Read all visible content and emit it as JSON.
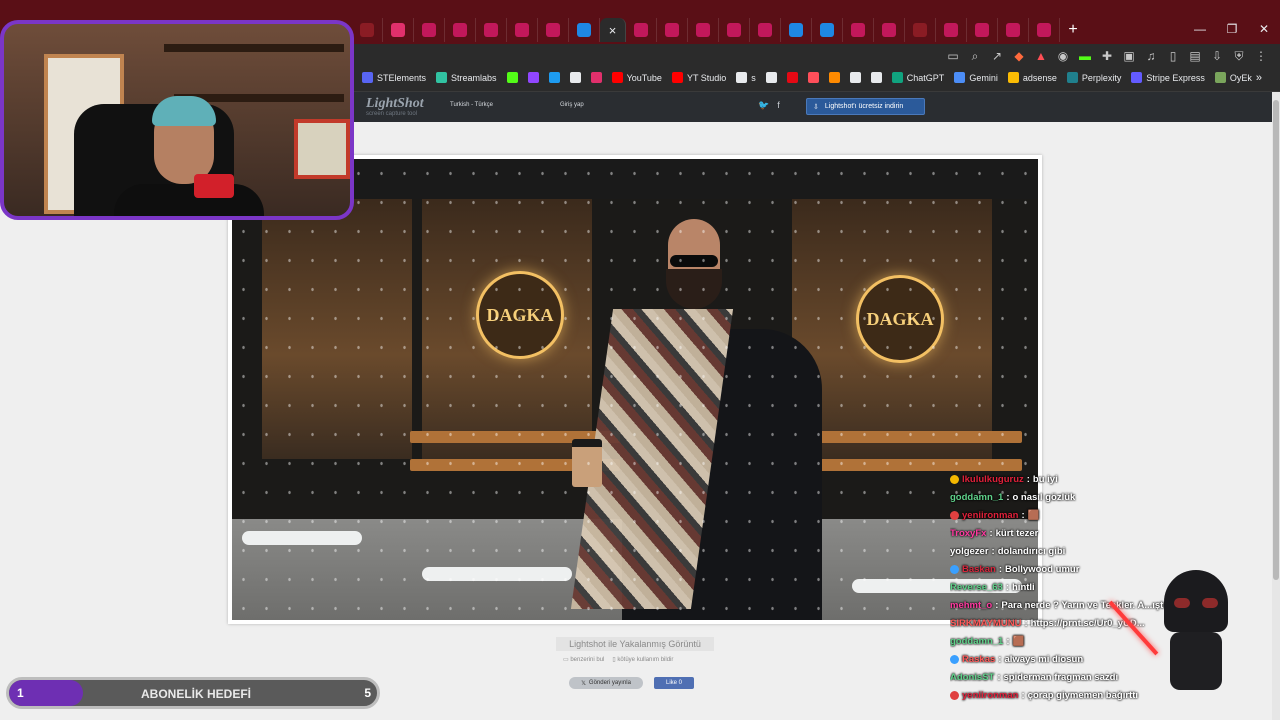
{
  "tabs": {
    "favicon_colors": [
      "#8a1c24",
      "#e1306c",
      "#c2185b",
      "#c2185b",
      "#c2185b",
      "#c2185b",
      "#c2185b",
      "#1e88e5",
      "#2b2b2b",
      "#c2185b",
      "#c2185b",
      "#c2185b",
      "#c2185b",
      "#c2185b",
      "#1e88e5",
      "#1e88e5",
      "#c2185b",
      "#c2185b",
      "#8a1c24",
      "#c2185b",
      "#c2185b",
      "#c2185b",
      "#c2185b"
    ],
    "active_index": 8,
    "close_glyph": "×",
    "new_tab_glyph": "+"
  },
  "window_controls": {
    "minimize": "—",
    "maximize": "❐",
    "close": "✕"
  },
  "bookmarks": [
    {
      "label": "STElements",
      "color": "#5865f2"
    },
    {
      "label": "Streamlabs",
      "color": "#31c3a2"
    },
    {
      "label": "",
      "color": "#53fc18"
    },
    {
      "label": "",
      "color": "#9146ff"
    },
    {
      "label": "",
      "color": "#1d9bf0"
    },
    {
      "label": "",
      "color": "#e8eaed",
      "glyph": "X"
    },
    {
      "label": "",
      "color": "#e1306c"
    },
    {
      "label": "YouTube",
      "color": "#ff0000"
    },
    {
      "label": "YT Studio",
      "color": "#ff0000"
    },
    {
      "label": "s",
      "color": "#e8eaed"
    },
    {
      "label": "",
      "color": "#e8eaed"
    },
    {
      "label": "",
      "color": "#e50914"
    },
    {
      "label": "",
      "color": "#ff4f5a"
    },
    {
      "label": "",
      "color": "#ff8a00"
    },
    {
      "label": "",
      "color": "#e8eaed"
    },
    {
      "label": "",
      "color": "#e8eaed"
    },
    {
      "label": "ChatGPT",
      "color": "#10a37f"
    },
    {
      "label": "Gemini",
      "color": "#4c8df6"
    },
    {
      "label": "adsense",
      "color": "#fbbc04"
    },
    {
      "label": "Perplexity",
      "color": "#20808d"
    },
    {
      "label": "Stripe Express",
      "color": "#635bff"
    },
    {
      "label": "OyEk",
      "color": "#7aa55c"
    }
  ],
  "bookmarks_more": "»",
  "lightshot": {
    "logo": "LightShot",
    "tagline": "screen capture tool",
    "language": "Turkish - Türkçe",
    "login": "Giriş yap",
    "social": [
      "🐦",
      "f"
    ],
    "download_label": "Lightshot'ı ücretsiz indirin",
    "caption": "Lightshot ile Yakalanmış Görüntü",
    "find_similar": "benzerini bul",
    "report_abuse": "kötüye kullanım bildir",
    "tweet_label": "Gönderi yayınla",
    "like_label": "Like 0"
  },
  "photo": {
    "sign_text": "DAGKA"
  },
  "chat": [
    {
      "user": "lkululkuguruz",
      "text": "bu iyi",
      "color": "#e0203a",
      "badge": "#f5b800"
    },
    {
      "user": "goddamn_1",
      "text": "o nasıl gözlük",
      "color": "#5fd18a",
      "badge": ""
    },
    {
      "user": "yeniironman",
      "text": "🟫",
      "color": "#e0203a",
      "badge": "#e04040"
    },
    {
      "user": "TroxyFx",
      "text": "kürt tezer",
      "color": "#ff3aa0",
      "badge": ""
    },
    {
      "user": "yolgezer",
      "text": "dolandırıcı gibi",
      "color": "#ffffff",
      "badge": ""
    },
    {
      "user": "Baskan",
      "text": "Bollywood umur",
      "color": "#d7263d",
      "badge": "#3aa0ff"
    },
    {
      "user": "Reverse_63",
      "text": "hintli",
      "color": "#5fd18a",
      "badge": ""
    },
    {
      "user": "mehmt_o",
      "text": "Para nerde ? Yarın ve Teekler. A...ıştırde.",
      "color": "#ff3aa0",
      "badge": ""
    },
    {
      "user": "SIRKMAYMUNU",
      "text": "https://prnt.sc/Ur0_yUD...",
      "color": "#ff5a5a",
      "badge": ""
    },
    {
      "user": "goddamn_1",
      "text": "🟫",
      "color": "#5fd18a",
      "badge": ""
    },
    {
      "user": "Raskas",
      "text": "always mi diosun",
      "color": "#ff5a5a",
      "badge": "#3aa0ff"
    },
    {
      "user": "AdonisST",
      "text": "spiderman fragman sazdı",
      "color": "#5fd18a",
      "badge": ""
    },
    {
      "user": "yeniironman",
      "text": "çorap giymemen bağırttı",
      "color": "#e0203a",
      "badge": "#e04040"
    }
  ],
  "goal": {
    "current": "1",
    "label": "ABONELİK HEDEFİ",
    "target": "5",
    "progress_fraction": 0.2,
    "fill_color": "#6e2fb3"
  }
}
